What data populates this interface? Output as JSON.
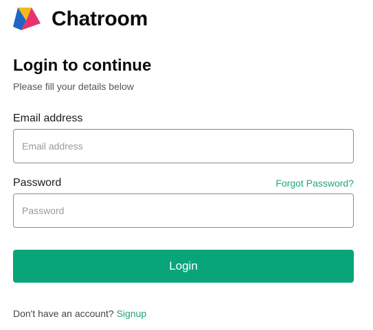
{
  "brand": {
    "name": "Chatroom",
    "logo_icon": "chatroom-logo-icon",
    "logo_colors": {
      "top": "#f2b91c",
      "left": "#1e66c4",
      "right": "#e6336b"
    }
  },
  "form": {
    "title": "Login to continue",
    "subtitle": "Please fill your details below",
    "email": {
      "label": "Email address",
      "placeholder": "Email address",
      "value": ""
    },
    "password": {
      "label": "Password",
      "placeholder": "Password",
      "value": "",
      "forgot_label": "Forgot Password?"
    },
    "submit_label": "Login",
    "signup_prompt": "Don't have an account?",
    "signup_link": "Signup"
  },
  "colors": {
    "accent": "#08a57b",
    "link": "#23a27b"
  }
}
